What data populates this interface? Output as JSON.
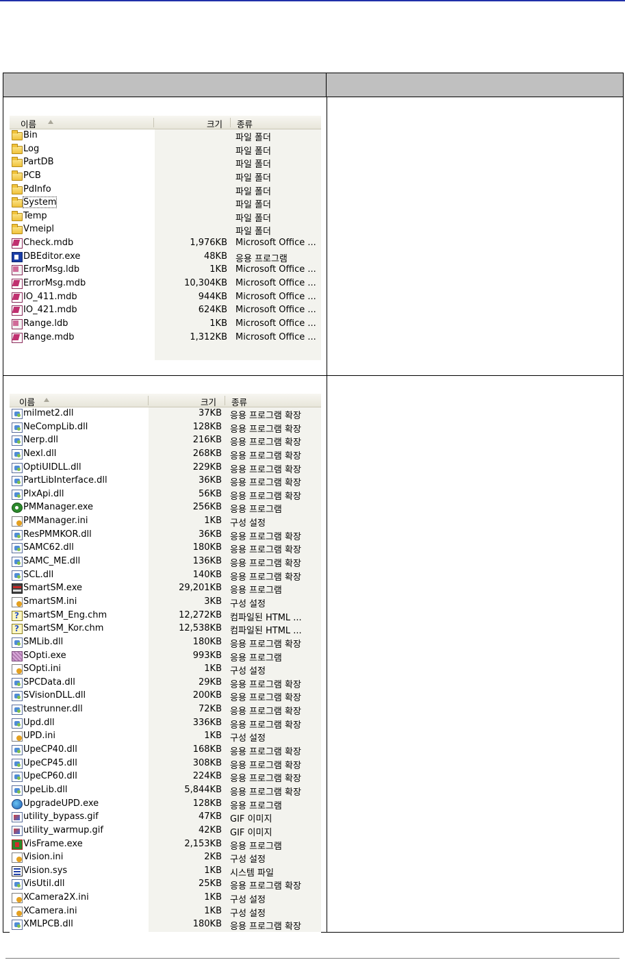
{
  "table": {
    "header_left": "",
    "header_right": ""
  },
  "explorer_top": {
    "columns": {
      "name": "이름",
      "size": "크기",
      "type": "종류"
    },
    "rows": [
      {
        "icon": "folder-icon",
        "name": "Bin",
        "size": "",
        "type": "파일 폴더"
      },
      {
        "icon": "folder-icon",
        "name": "Log",
        "size": "",
        "type": "파일 폴더"
      },
      {
        "icon": "folder-icon",
        "name": "PartDB",
        "size": "",
        "type": "파일 폴더"
      },
      {
        "icon": "folder-icon",
        "name": "PCB",
        "size": "",
        "type": "파일 폴더"
      },
      {
        "icon": "folder-icon",
        "name": "PdInfo",
        "size": "",
        "type": "파일 폴더"
      },
      {
        "icon": "folder-icon",
        "name": "System",
        "size": "",
        "type": "파일 폴더",
        "focused": true
      },
      {
        "icon": "folder-icon",
        "name": "Temp",
        "size": "",
        "type": "파일 폴더"
      },
      {
        "icon": "folder-icon",
        "name": "Vmeipl",
        "size": "",
        "type": "파일 폴더"
      },
      {
        "icon": "mdb-icon",
        "name": "Check.mdb",
        "size": "1,976KB",
        "type": "Microsoft Office ..."
      },
      {
        "icon": "exe-blue-icon",
        "name": "DBEditor.exe",
        "size": "48KB",
        "type": "응용 프로그램"
      },
      {
        "icon": "ldb-icon",
        "name": "ErrorMsg.ldb",
        "size": "1KB",
        "type": "Microsoft Office ..."
      },
      {
        "icon": "mdb-icon",
        "name": "ErrorMsg.mdb",
        "size": "10,304KB",
        "type": "Microsoft Office ..."
      },
      {
        "icon": "mdb-icon",
        "name": "IO_411.mdb",
        "size": "944KB",
        "type": "Microsoft Office ..."
      },
      {
        "icon": "mdb-icon",
        "name": "IO_421.mdb",
        "size": "624KB",
        "type": "Microsoft Office ..."
      },
      {
        "icon": "ldb-icon",
        "name": "Range.ldb",
        "size": "1KB",
        "type": "Microsoft Office ..."
      },
      {
        "icon": "mdb-icon",
        "name": "Range.mdb",
        "size": "1,312KB",
        "type": "Microsoft Office ..."
      }
    ]
  },
  "explorer_bottom": {
    "columns": {
      "name": "이름",
      "size": "크기",
      "type": "종류"
    },
    "rows": [
      {
        "icon": "dll-icon",
        "name": "milmet2.dll",
        "size": "37KB",
        "type": "응용 프로그램 확장"
      },
      {
        "icon": "dll-icon",
        "name": "NeCompLib.dll",
        "size": "128KB",
        "type": "응용 프로그램 확장"
      },
      {
        "icon": "dll-icon",
        "name": "Nerp.dll",
        "size": "216KB",
        "type": "응용 프로그램 확장"
      },
      {
        "icon": "dll-icon",
        "name": "Nexl.dll",
        "size": "268KB",
        "type": "응용 프로그램 확장"
      },
      {
        "icon": "dll-icon",
        "name": "OptiUIDLL.dll",
        "size": "229KB",
        "type": "응용 프로그램 확장"
      },
      {
        "icon": "dll-icon",
        "name": "PartLibInterface.dll",
        "size": "36KB",
        "type": "응용 프로그램 확장"
      },
      {
        "icon": "dll-icon",
        "name": "PlxApi.dll",
        "size": "56KB",
        "type": "응용 프로그램 확장"
      },
      {
        "icon": "pm-icon",
        "name": "PMManager.exe",
        "size": "256KB",
        "type": "응용 프로그램"
      },
      {
        "icon": "ini-icon",
        "name": "PMManager.ini",
        "size": "1KB",
        "type": "구성 설정"
      },
      {
        "icon": "dll-icon",
        "name": "ResPMMKOR.dll",
        "size": "36KB",
        "type": "응용 프로그램 확장"
      },
      {
        "icon": "dll-icon",
        "name": "SAMC62.dll",
        "size": "180KB",
        "type": "응용 프로그램 확장"
      },
      {
        "icon": "dll-icon",
        "name": "SAMC_ME.dll",
        "size": "136KB",
        "type": "응용 프로그램 확장"
      },
      {
        "icon": "dll-icon",
        "name": "SCL.dll",
        "size": "140KB",
        "type": "응용 프로그램 확장"
      },
      {
        "icon": "smartsm-icon",
        "name": "SmartSM.exe",
        "size": "29,201KB",
        "type": "응용 프로그램"
      },
      {
        "icon": "ini-icon",
        "name": "SmartSM.ini",
        "size": "3KB",
        "type": "구성 설정"
      },
      {
        "icon": "chm-icon",
        "name": "SmartSM_Eng.chm",
        "size": "12,272KB",
        "type": "컴파일된 HTML ..."
      },
      {
        "icon": "chm-icon",
        "name": "SmartSM_Kor.chm",
        "size": "12,538KB",
        "type": "컴파일된 HTML ..."
      },
      {
        "icon": "dll-icon",
        "name": "SMLib.dll",
        "size": "180KB",
        "type": "응용 프로그램 확장"
      },
      {
        "icon": "sopti-icon",
        "name": "SOpti.exe",
        "size": "993KB",
        "type": "응용 프로그램"
      },
      {
        "icon": "ini-icon",
        "name": "SOpti.ini",
        "size": "1KB",
        "type": "구성 설정"
      },
      {
        "icon": "dll-icon",
        "name": "SPCData.dll",
        "size": "29KB",
        "type": "응용 프로그램 확장"
      },
      {
        "icon": "dll-icon",
        "name": "SVisionDLL.dll",
        "size": "200KB",
        "type": "응용 프로그램 확장"
      },
      {
        "icon": "dll-icon",
        "name": "testrunner.dll",
        "size": "72KB",
        "type": "응용 프로그램 확장"
      },
      {
        "icon": "dll-icon",
        "name": "Upd.dll",
        "size": "336KB",
        "type": "응용 프로그램 확장"
      },
      {
        "icon": "ini-icon",
        "name": "UPD.ini",
        "size": "1KB",
        "type": "구성 설정"
      },
      {
        "icon": "dll-icon",
        "name": "UpeCP40.dll",
        "size": "168KB",
        "type": "응용 프로그램 확장"
      },
      {
        "icon": "dll-icon",
        "name": "UpeCP45.dll",
        "size": "308KB",
        "type": "응용 프로그램 확장"
      },
      {
        "icon": "dll-icon",
        "name": "UpeCP60.dll",
        "size": "224KB",
        "type": "응용 프로그램 확장"
      },
      {
        "icon": "dll-icon",
        "name": "UpeLib.dll",
        "size": "5,844KB",
        "type": "응용 프로그램 확장"
      },
      {
        "icon": "upgrade-icon",
        "name": "UpgradeUPD.exe",
        "size": "128KB",
        "type": "응용 프로그램"
      },
      {
        "icon": "gif-icon",
        "name": "utility_bypass.gif",
        "size": "47KB",
        "type": "GIF 이미지"
      },
      {
        "icon": "gif-icon",
        "name": "utility_warmup.gif",
        "size": "42KB",
        "type": "GIF 이미지"
      },
      {
        "icon": "visframe-icon",
        "name": "VisFrame.exe",
        "size": "2,153KB",
        "type": "응용 프로그램"
      },
      {
        "icon": "ini-icon",
        "name": "Vision.ini",
        "size": "2KB",
        "type": "구성 설정"
      },
      {
        "icon": "sys-icon",
        "name": "Vision.sys",
        "size": "1KB",
        "type": "시스템 파일"
      },
      {
        "icon": "dll-icon",
        "name": "VisUtil.dll",
        "size": "25KB",
        "type": "응용 프로그램 확장"
      },
      {
        "icon": "ini-icon",
        "name": "XCamera2X.ini",
        "size": "1KB",
        "type": "구성 설정"
      },
      {
        "icon": "ini-icon",
        "name": "XCamera.ini",
        "size": "1KB",
        "type": "구성 설정"
      },
      {
        "icon": "dll-icon",
        "name": "XMLPCB.dll",
        "size": "180KB",
        "type": "응용 프로그램 확장"
      }
    ]
  }
}
